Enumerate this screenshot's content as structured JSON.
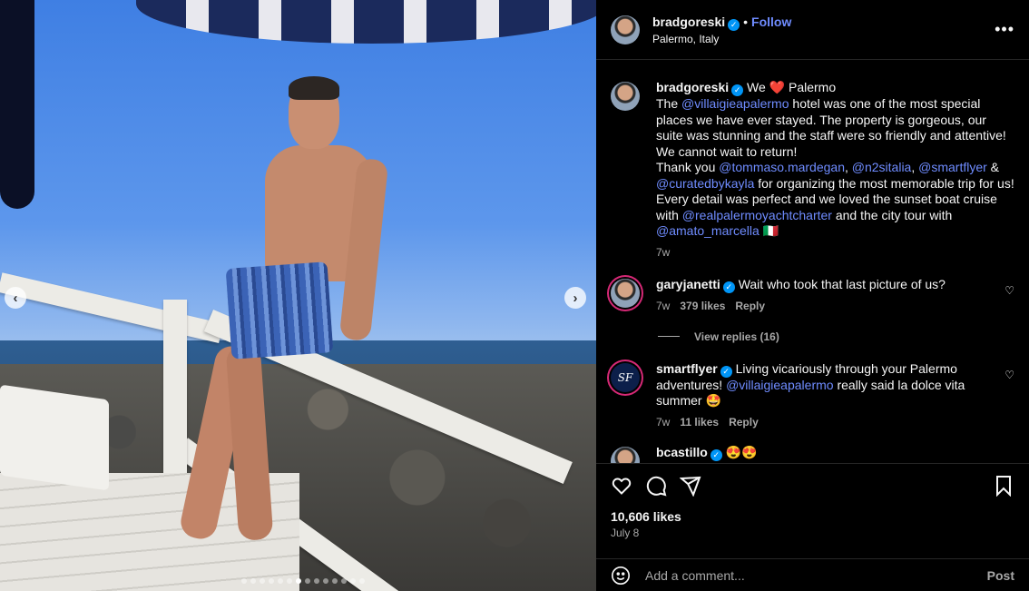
{
  "post": {
    "author": "bradgoreski",
    "follow_label": "Follow",
    "separator": "•",
    "location": "Palermo, Italy",
    "more_label": "•••"
  },
  "caption": {
    "username": "bradgoreski",
    "p1": " We ",
    "heart": "❤️",
    "p2": " Palermo",
    "p3": "The ",
    "m1": "@villaigieapalermo",
    "p4": " hotel was one of the most special places we have ever stayed. The property is gorgeous, our suite was stunning and the staff were so friendly and attentive! We cannot wait to return!",
    "p5": "Thank you ",
    "m2": "@tommaso.mardegan",
    "p6": ", ",
    "m3": "@n2sitalia",
    "p7": ", ",
    "m4": "@smartflyer",
    "p8": " & ",
    "m5": "@curatedbykayla",
    "p9": " for organizing the most memorable trip for us! Every detail was perfect and we loved the sunset boat cruise with ",
    "m6": "@realpalermoyachtcharter",
    "p10": " and the city tour with ",
    "m7": "@amato_marcella",
    "flag": " 🇮🇹",
    "time": "7w"
  },
  "comments": [
    {
      "username": "garyjanetti",
      "text": " Wait who took that last picture of us?",
      "time": "7w",
      "likes": "379 likes",
      "reply": "Reply",
      "view_replies": "View replies (16)"
    },
    {
      "username": "smartflyer",
      "avatar_text": "SF",
      "text_a": " Living vicariously through your Palermo adventures! ",
      "mention": "@villaigieapalermo",
      "text_b": " really said la dolce vita summer ",
      "emoji": "🤩",
      "time": "7w",
      "likes": "11 likes",
      "reply": "Reply"
    },
    {
      "username": "bcastillo",
      "emoji": "😍😍"
    }
  ],
  "footer": {
    "likes": "10,606 likes",
    "date": "July 8",
    "comment_placeholder": "Add a comment...",
    "post_label": "Post"
  },
  "photo": {
    "prev_label": "‹",
    "next_label": "›",
    "slide_count": 14,
    "active_slide": 6
  },
  "colors": {
    "mention": "#6f8cff",
    "verified": "#0095f6",
    "background": "#000000"
  }
}
